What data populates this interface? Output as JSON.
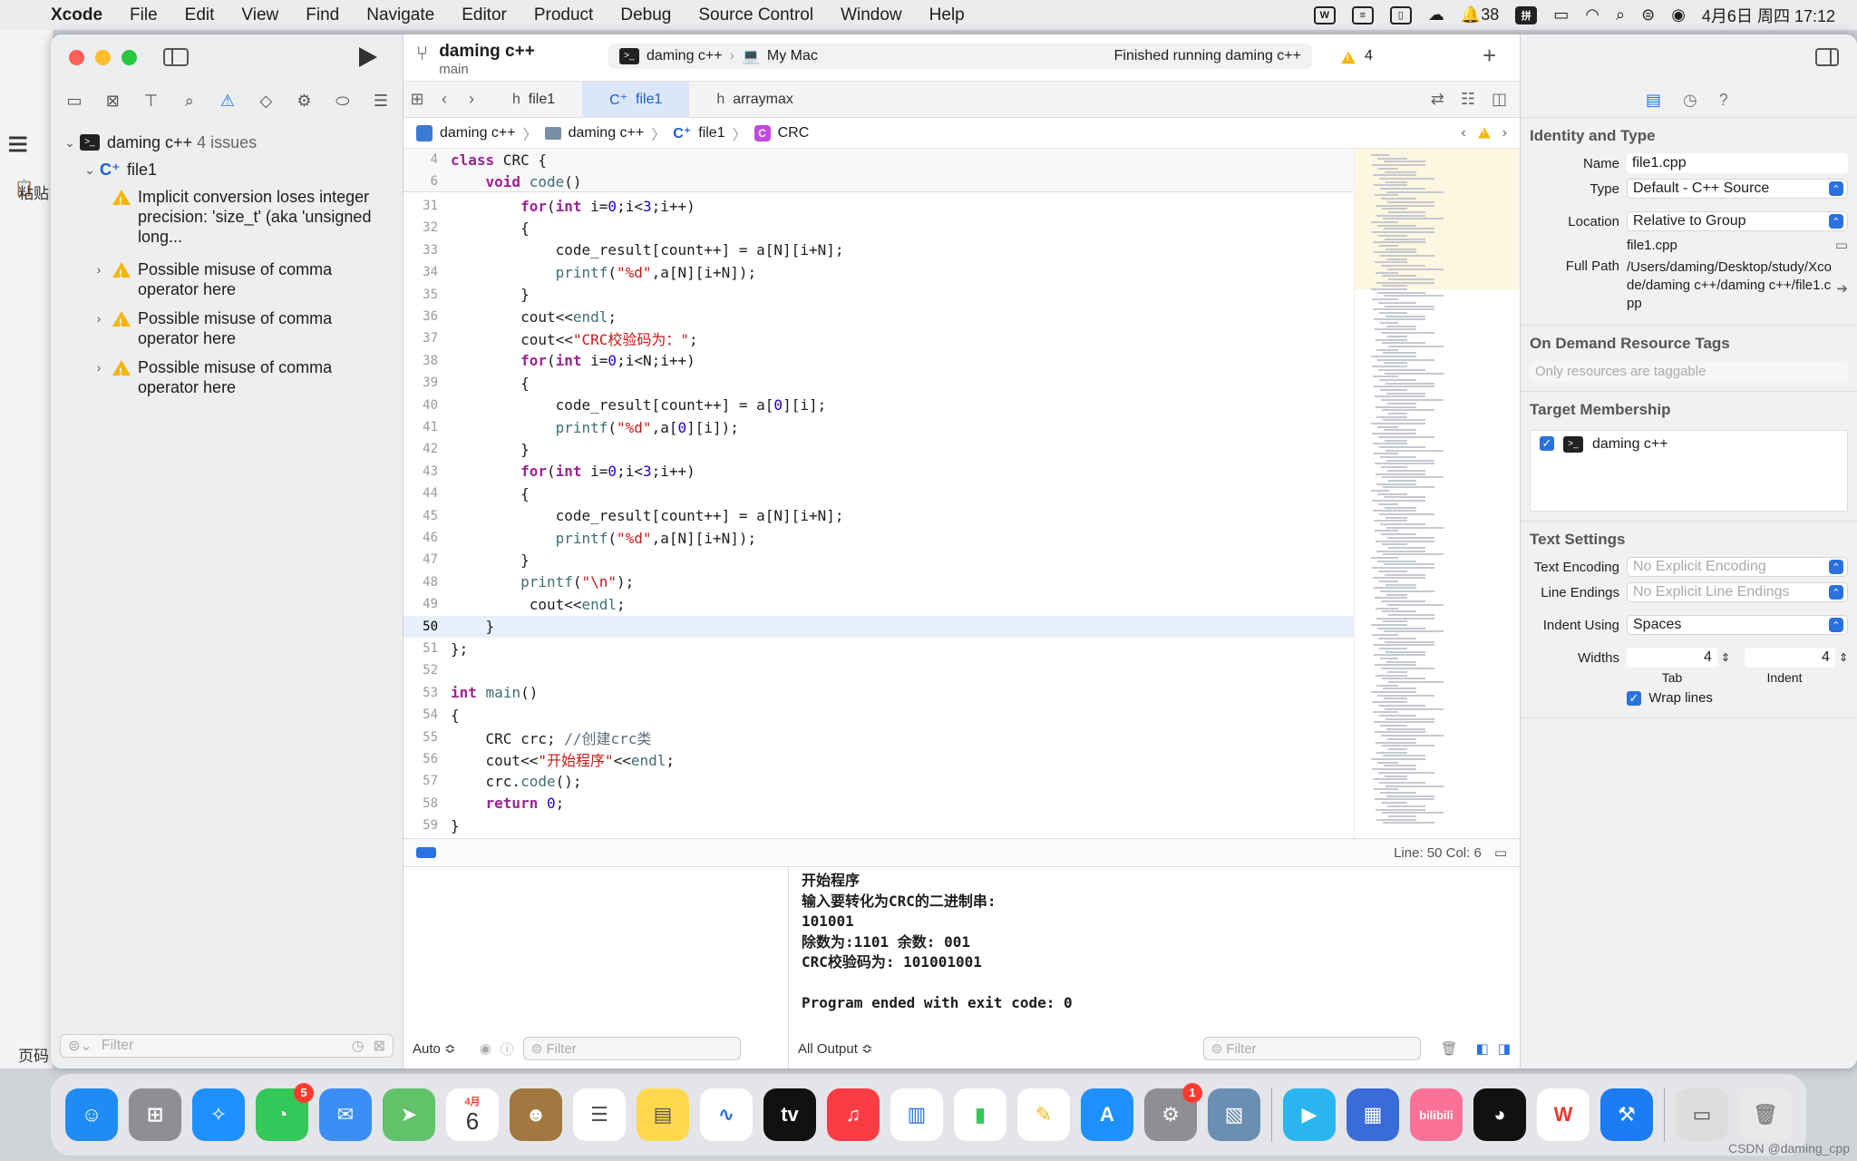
{
  "menubar": {
    "app": "Xcode",
    "items": [
      "File",
      "Edit",
      "View",
      "Find",
      "Navigate",
      "Editor",
      "Product",
      "Debug",
      "Source Control",
      "Window",
      "Help"
    ],
    "notif_count": "38",
    "input_method": "拼",
    "datetime": "4月6日 周四  17:12"
  },
  "desktop": {
    "paste_label": "粘贴",
    "page_label": "页码"
  },
  "toolbar": {
    "project": "daming c++",
    "branch": "main",
    "scheme": "daming c++",
    "destination": "My Mac",
    "status": "Finished running daming c++",
    "warnings": "4"
  },
  "tabs": [
    "file1",
    "file1",
    "arraymax"
  ],
  "breadcrumbs": [
    "daming c++",
    "daming c++",
    "file1",
    "CRC"
  ],
  "navigator": {
    "project": "daming c++",
    "issues_count": "4 issues",
    "file": "file1",
    "issues": [
      "Implicit conversion loses integer precision: 'size_t' (aka 'unsigned long...",
      "Possible misuse of comma operator here",
      "Possible misuse of comma operator here",
      "Possible misuse of comma operator here"
    ],
    "filter_placeholder": "Filter"
  },
  "editor": {
    "sticky": [
      {
        "n": "4",
        "t": "class CRC {"
      },
      {
        "n": "6",
        "t": "    void code()"
      }
    ],
    "lines": [
      {
        "n": "31",
        "t": "        for(int i=0;i<3;i++)"
      },
      {
        "n": "32",
        "t": "        {"
      },
      {
        "n": "33",
        "t": "            code_result[count++] = a[N][i+N];"
      },
      {
        "n": "34",
        "t": "            printf(\"%d\",a[N][i+N]);"
      },
      {
        "n": "35",
        "t": "        }"
      },
      {
        "n": "36",
        "t": "        cout<<endl;"
      },
      {
        "n": "37",
        "t": "        cout<<\"CRC校验码为：\";"
      },
      {
        "n": "38",
        "t": "        for(int i=0;i<N;i++)"
      },
      {
        "n": "39",
        "t": "        {"
      },
      {
        "n": "40",
        "t": "            code_result[count++] = a[0][i];"
      },
      {
        "n": "41",
        "t": "            printf(\"%d\",a[0][i]);"
      },
      {
        "n": "42",
        "t": "        }"
      },
      {
        "n": "43",
        "t": "        for(int i=0;i<3;i++)"
      },
      {
        "n": "44",
        "t": "        {"
      },
      {
        "n": "45",
        "t": "            code_result[count++] = a[N][i+N];"
      },
      {
        "n": "46",
        "t": "            printf(\"%d\",a[N][i+N]);"
      },
      {
        "n": "47",
        "t": "        }"
      },
      {
        "n": "48",
        "t": "        printf(\"\\n\");"
      },
      {
        "n": "49",
        "t": "         cout<<endl;"
      },
      {
        "n": "50",
        "t": "    }"
      },
      {
        "n": "51",
        "t": "};"
      },
      {
        "n": "52",
        "t": ""
      },
      {
        "n": "53",
        "t": "int main()"
      },
      {
        "n": "54",
        "t": "{"
      },
      {
        "n": "55",
        "t": "    CRC crc; //创建crc类"
      },
      {
        "n": "56",
        "t": "    cout<<\"开始程序\"<<endl;"
      },
      {
        "n": "57",
        "t": "    crc.code();"
      },
      {
        "n": "58",
        "t": "    return 0;"
      },
      {
        "n": "59",
        "t": "}"
      }
    ],
    "current_line": "50"
  },
  "status": {
    "line_col": "Line: 50  Col: 6"
  },
  "debug": {
    "auto_label": "Auto ≎",
    "output_label": "All Output ≎",
    "filter_placeholder": "Filter",
    "console": [
      "开始程序",
      "输入要转化为CRC的二进制串:",
      "101001",
      "除数为:1101 余数: 001",
      "CRC校验码为: 101001001",
      "",
      "Program ended with exit code: 0"
    ]
  },
  "inspector": {
    "identity_title": "Identity and Type",
    "name_label": "Name",
    "name_value": "file1.cpp",
    "type_label": "Type",
    "type_value": "Default - C++ Source",
    "location_label": "Location",
    "location_value": "Relative to Group",
    "location_file": "file1.cpp",
    "fullpath_label": "Full Path",
    "fullpath_value": "/Users/daming/Desktop/study/Xcode/daming c++/daming c++/file1.cpp",
    "ondemand_title": "On Demand Resource Tags",
    "ondemand_placeholder": "Only resources are taggable",
    "target_title": "Target Membership",
    "target_name": "daming c++",
    "text_title": "Text Settings",
    "encoding_label": "Text Encoding",
    "encoding_value": "No Explicit Encoding",
    "endings_label": "Line Endings",
    "endings_value": "No Explicit Line Endings",
    "indent_label": "Indent Using",
    "indent_value": "Spaces",
    "widths_label": "Widths",
    "tab_value": "4",
    "indent_width_value": "4",
    "tab_label": "Tab",
    "indent_sublabel": "Indent",
    "wrap_label": "Wrap lines"
  },
  "dock": {
    "calendar_month": "4月",
    "calendar_day": "6",
    "messages_badge": "5",
    "settings_badge": "1",
    "bilibili": "bilibili"
  },
  "watermark": "CSDN @daming_cpp",
  "colors": {
    "accent": "#2a72e0",
    "warning": "#f5b60b",
    "keyword": "#9b2393",
    "string": "#c41a16",
    "number": "#1c00cf"
  }
}
